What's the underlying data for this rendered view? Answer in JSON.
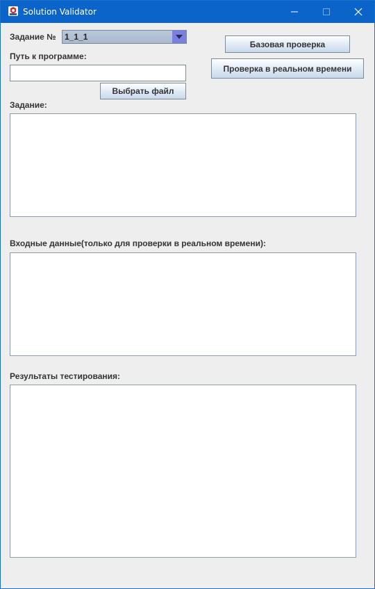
{
  "window": {
    "title": "Solution Validator",
    "accent_color": "#0a64c9",
    "controls": {
      "minimize": "minimize-icon",
      "maximize": "maximize-icon",
      "close": "close-icon"
    }
  },
  "task_selector": {
    "label": "Задание №",
    "selected_value": "1_1_1"
  },
  "program_path": {
    "label": "Путь к программе:",
    "value": "",
    "choose_file_label": "Выбрать файл"
  },
  "actions": {
    "basic_check_label": "Базовая проверка",
    "realtime_check_label": "Проверка в реальном времени"
  },
  "task_section": {
    "label": "Задание:",
    "content": ""
  },
  "input_section": {
    "label": "Входные данные(только для проверки в реальном времени):",
    "content": ""
  },
  "results_section": {
    "label": "Результаты тестирования:",
    "content": ""
  }
}
